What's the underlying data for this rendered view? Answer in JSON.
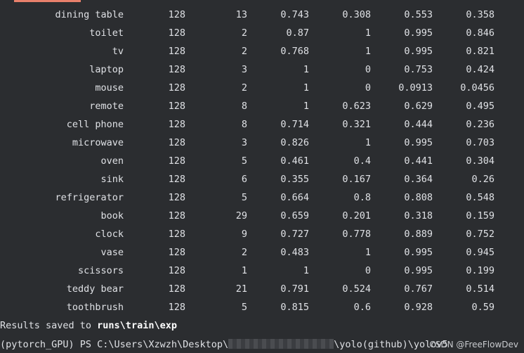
{
  "rows": [
    [
      "dining table",
      "128",
      "13",
      "0.743",
      "0.308",
      "0.553",
      "0.358"
    ],
    [
      "toilet",
      "128",
      "2",
      "0.87",
      "1",
      "0.995",
      "0.846"
    ],
    [
      "tv",
      "128",
      "2",
      "0.768",
      "1",
      "0.995",
      "0.821"
    ],
    [
      "laptop",
      "128",
      "3",
      "1",
      "0",
      "0.753",
      "0.424"
    ],
    [
      "mouse",
      "128",
      "2",
      "1",
      "0",
      "0.0913",
      "0.0456"
    ],
    [
      "remote",
      "128",
      "8",
      "1",
      "0.623",
      "0.629",
      "0.495"
    ],
    [
      "cell phone",
      "128",
      "8",
      "0.714",
      "0.321",
      "0.444",
      "0.236"
    ],
    [
      "microwave",
      "128",
      "3",
      "0.826",
      "1",
      "0.995",
      "0.703"
    ],
    [
      "oven",
      "128",
      "5",
      "0.461",
      "0.4",
      "0.441",
      "0.304"
    ],
    [
      "sink",
      "128",
      "6",
      "0.355",
      "0.167",
      "0.364",
      "0.26"
    ],
    [
      "refrigerator",
      "128",
      "5",
      "0.664",
      "0.8",
      "0.808",
      "0.548"
    ],
    [
      "book",
      "128",
      "29",
      "0.659",
      "0.201",
      "0.318",
      "0.159"
    ],
    [
      "clock",
      "128",
      "9",
      "0.727",
      "0.778",
      "0.889",
      "0.752"
    ],
    [
      "vase",
      "128",
      "2",
      "0.483",
      "1",
      "0.995",
      "0.945"
    ],
    [
      "scissors",
      "128",
      "1",
      "1",
      "0",
      "0.995",
      "0.199"
    ],
    [
      "teddy bear",
      "128",
      "21",
      "0.791",
      "0.524",
      "0.767",
      "0.514"
    ],
    [
      "toothbrush",
      "128",
      "5",
      "0.815",
      "0.6",
      "0.928",
      "0.59"
    ]
  ],
  "results": {
    "prefix": "Results saved to ",
    "path": "runs\\train\\exp"
  },
  "prompt": {
    "start": "(pytorch_GPU) PS C:\\Users\\Xzwzh\\Desktop\\",
    "end": "\\yolo(github)\\yolov5"
  },
  "watermark": "CSDN @FreeFlowDev",
  "colors": {
    "background": "#2b2d30",
    "text": "#dfe1e5",
    "tab_accent": "#e8806b"
  }
}
